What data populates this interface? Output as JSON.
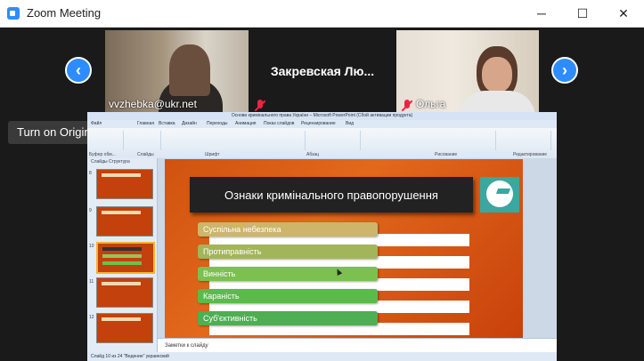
{
  "window": {
    "title": "Zoom Meeting",
    "minimize": "─",
    "maximize": "☐",
    "close": "✕"
  },
  "participants": {
    "tile1": {
      "name": "vvzhebka@ukr.net"
    },
    "tile2": {
      "name": "Закревская  Лю..."
    },
    "tile3": {
      "name": "Ольга"
    }
  },
  "nav": {
    "prev": "‹",
    "next": "›"
  },
  "tooltip": "Turn on Original Sound",
  "ppt": {
    "title": "Основи  кримінального права України  –  Microsoft PowerPoint (Сбой активации продукта)",
    "tabs": [
      "Файл",
      "Главная",
      "Вставка",
      "Дизайн",
      "Переходы",
      "Анимация",
      "Показ слайдов",
      "Рецензирование",
      "Вид"
    ],
    "groups": [
      "Буфер обм...",
      "Слайды",
      "Шрифт",
      "Абзац",
      "Рисование",
      "Редактирование"
    ],
    "panel_tabs": "Слайды   Структура",
    "thumb_numbers": [
      "8",
      "9",
      "10",
      "11",
      "12"
    ],
    "slide": {
      "heading": "Ознаки кримінального правопорушення",
      "items": [
        {
          "label": "Суспільна небезпека",
          "color": "#cdb56a"
        },
        {
          "label": "Протиправність",
          "color": "#a3b55a"
        },
        {
          "label": "Винність",
          "color": "#7cc04f"
        },
        {
          "label": "Караність",
          "color": "#5bbb4a"
        },
        {
          "label": "Суб'єктивність",
          "color": "#4daf52"
        }
      ]
    },
    "notes": "Заметки к слайду",
    "status": "Слайд 10 из 24   \"Ведение\"   украинский"
  }
}
